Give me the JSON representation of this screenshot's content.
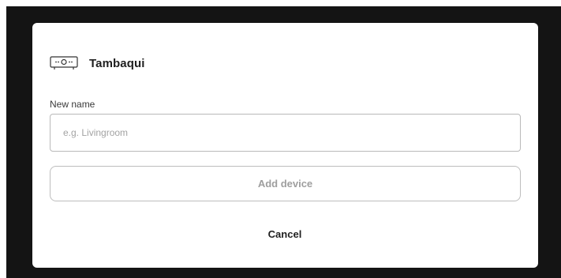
{
  "dialog": {
    "device_icon": "projector-icon",
    "device_name": "Tambaqui",
    "field_label": "New name",
    "input_value": "",
    "input_placeholder": "e.g. Livingroom",
    "add_label": "Add device",
    "cancel_label": "Cancel"
  },
  "colors": {
    "backdrop": "#141414",
    "surface": "#ffffff",
    "text_primary": "#1f1f1f",
    "text_disabled": "#9e9e9e",
    "border": "#b9b9b9"
  }
}
